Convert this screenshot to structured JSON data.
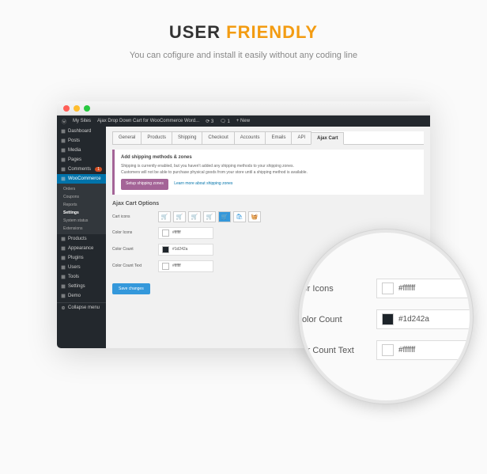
{
  "hero": {
    "word1": "USER",
    "word2": "FRIENDLY",
    "subtitle": "You can cofigure and install it easily without any coding line"
  },
  "adminbar": {
    "mysites": "My Sites",
    "site": "Ajax Drop Down Cart for WooCommerce Word...",
    "updates": "3",
    "comments": "1",
    "new": "+ New"
  },
  "sidebar": {
    "items": [
      {
        "label": "Dashboard"
      },
      {
        "label": "Posts"
      },
      {
        "label": "Media"
      },
      {
        "label": "Pages"
      },
      {
        "label": "Comments",
        "badge": "1"
      },
      {
        "label": "WooCommerce"
      }
    ],
    "sub": [
      "Orders",
      "Coupons",
      "Reports",
      "Settings",
      "System status",
      "Extensions"
    ],
    "sub_active_index": 3,
    "items2": [
      {
        "label": "Products"
      },
      {
        "label": "Appearance"
      },
      {
        "label": "Plugins"
      },
      {
        "label": "Users"
      },
      {
        "label": "Tools"
      },
      {
        "label": "Settings"
      },
      {
        "label": "Demo"
      }
    ],
    "collapse": "Collapse menu"
  },
  "tabs": [
    "General",
    "Products",
    "Shipping",
    "Checkout",
    "Accounts",
    "Emails",
    "API",
    "Ajax Cart"
  ],
  "tabs_active_index": 7,
  "notice": {
    "title": "Add shipping methods & zones",
    "line1": "Shipping is currently enabled, but you haven't added any shipping methods to your shipping zones.",
    "line2": "Customers will not be able to purchase physical goods from your store until a shipping method is available.",
    "btn": "Setup shipping zones",
    "link": "Learn more about shipping zones"
  },
  "section_title": "Ajax Cart Options",
  "fields": {
    "cart_icons": "Cart icons",
    "color_icons": {
      "label": "Color Icons",
      "value": "#ffffff",
      "swatch": "#ffffff"
    },
    "color_count": {
      "label": "Color Count",
      "value": "#1d242a",
      "swatch": "#1d242a"
    },
    "color_count_text": {
      "label": "Color Count Text",
      "value": "#ffffff",
      "swatch": "#ffffff"
    }
  },
  "save": "Save changes",
  "mag": {
    "color_icons": {
      "label": "olor Icons",
      "value": "#ffffff",
      "swatch": "#ffffff"
    },
    "color_count": {
      "label": "Color Count",
      "value": "#1d242a",
      "swatch": "#1d242a"
    },
    "color_count_text": {
      "label": "olor Count Text",
      "value": "#ffffff",
      "swatch": "#ffffff"
    }
  }
}
